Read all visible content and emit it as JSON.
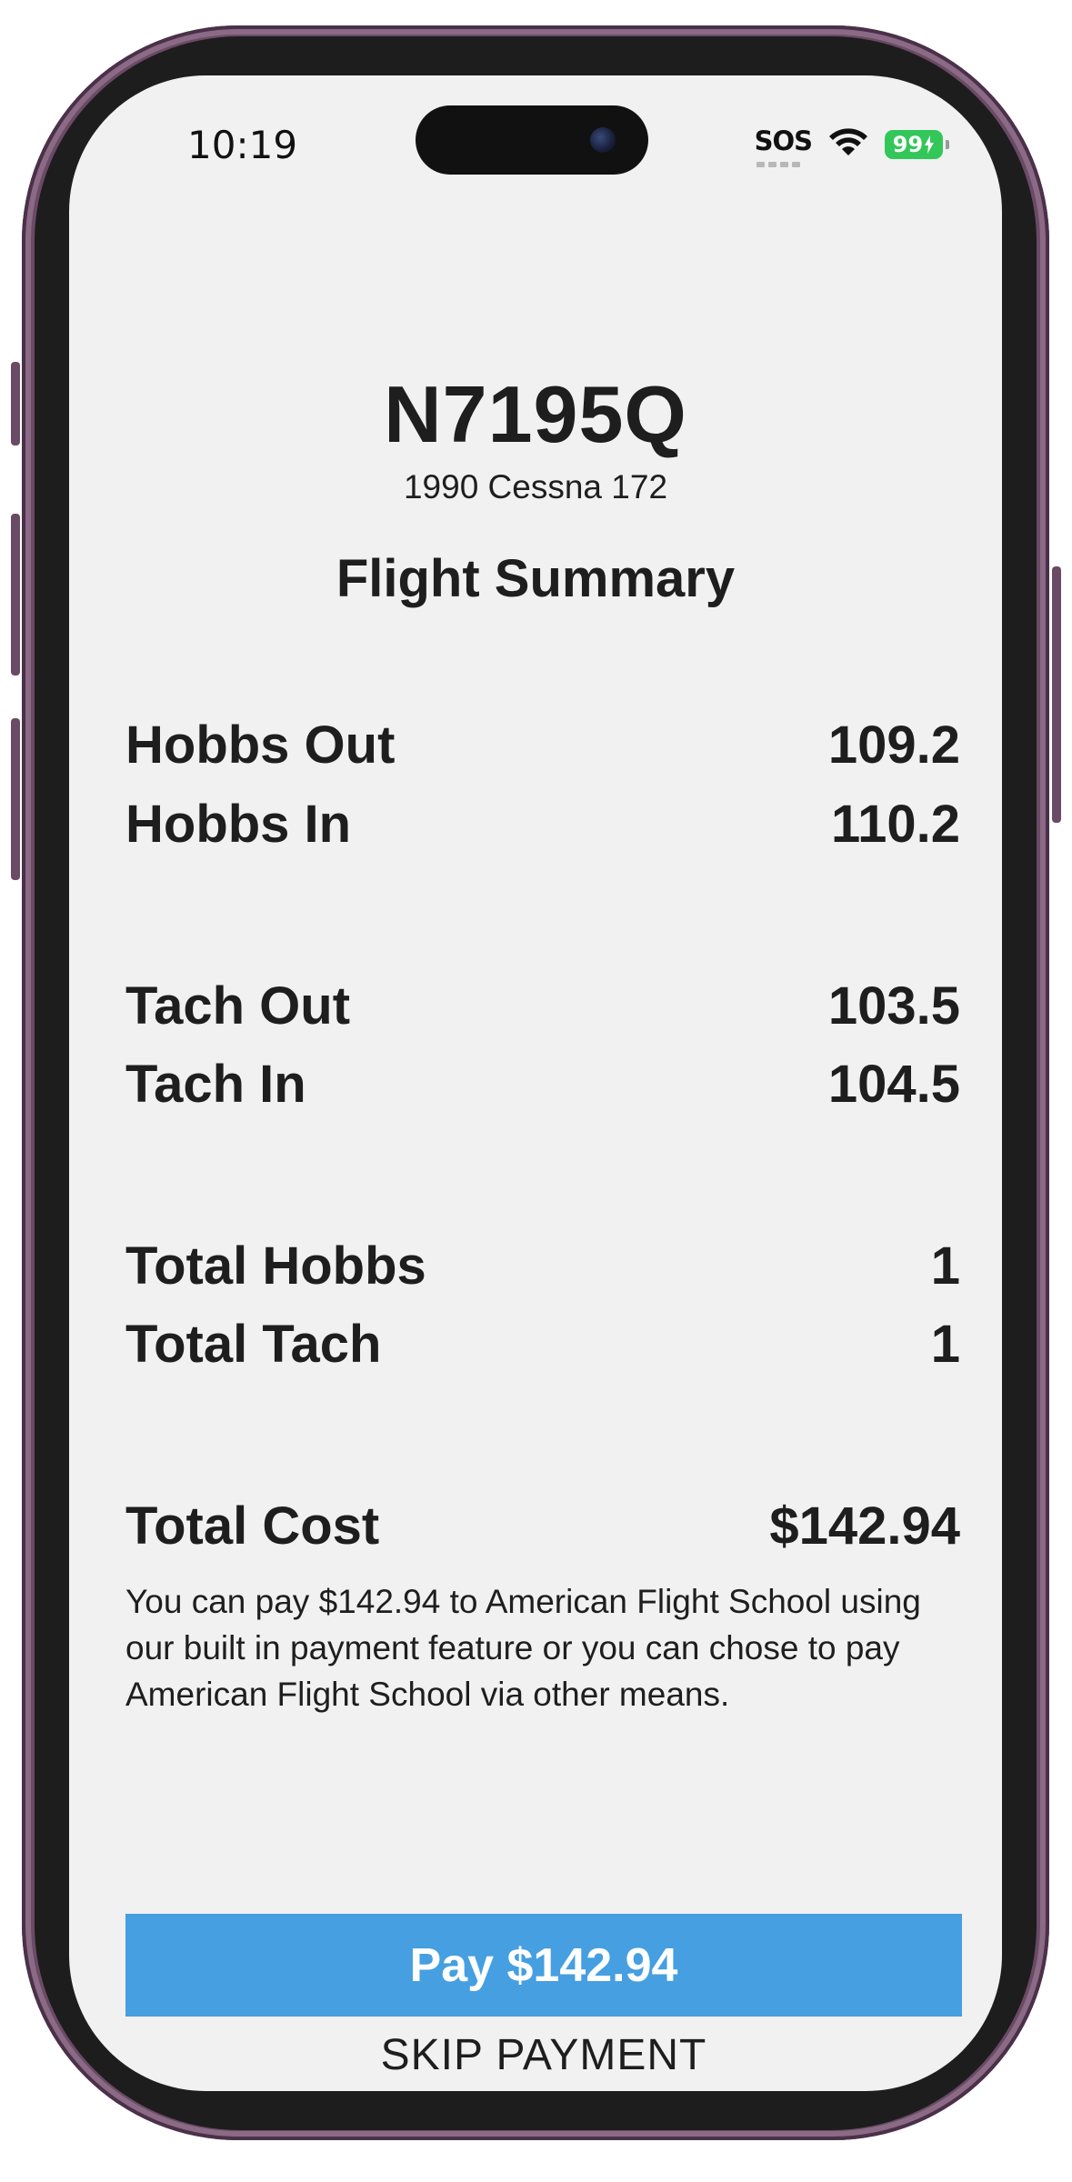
{
  "status_bar": {
    "time": "10:19",
    "carrier": "SOS",
    "battery": "99"
  },
  "aircraft": {
    "tail_number": "N7195Q",
    "model": "1990 Cessna 172"
  },
  "summary": {
    "title": "Flight Summary",
    "rows": [
      {
        "label": "Hobbs Out",
        "value": "109.2"
      },
      {
        "label": "Hobbs In",
        "value": "110.2"
      },
      {
        "label": "Tach Out",
        "value": "103.5"
      },
      {
        "label": "Tach In",
        "value": "104.5"
      },
      {
        "label": "Total Hobbs",
        "value": "1"
      },
      {
        "label": "Total Tach",
        "value": "1"
      },
      {
        "label": "Total Cost",
        "value": "$142.94"
      }
    ],
    "payment_note": "You can pay $142.94 to American Flight School using our built in payment feature or you can chose to pay American Flight School via other means."
  },
  "actions": {
    "pay_label": "Pay $142.94",
    "skip_label": "SKIP PAYMENT"
  },
  "colors": {
    "pay_button": "#459fe0",
    "battery": "#33c759",
    "screen_background": "#f1f1f1",
    "frame": "#6b4a66"
  },
  "icons": {
    "wifi": "wifi-icon",
    "battery": "battery-icon",
    "camera": "camera-icon"
  }
}
